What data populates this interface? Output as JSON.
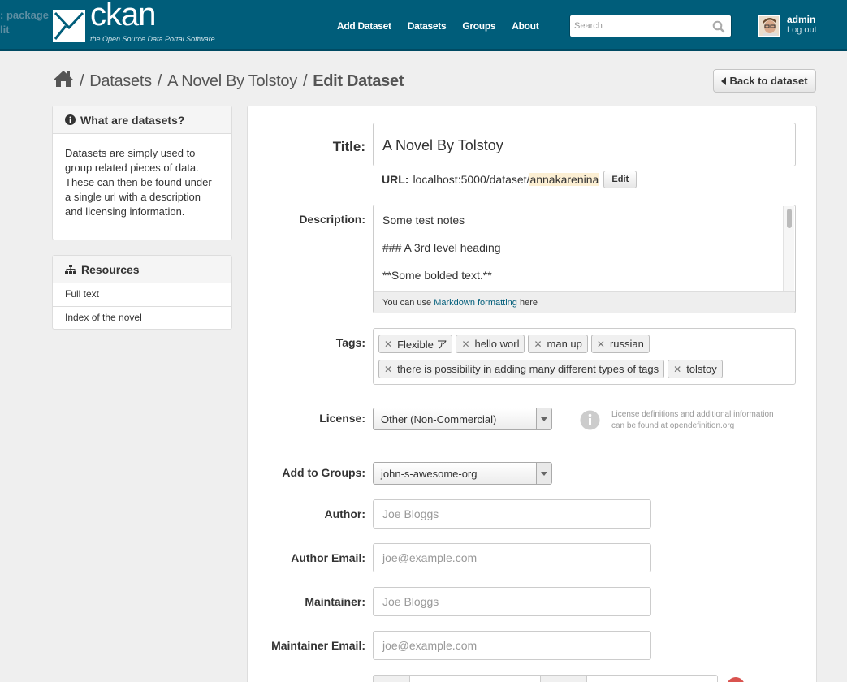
{
  "header": {
    "stray_text_1": ": package",
    "stray_text_2": "lit",
    "brand_name": "ckan",
    "brand_tagline": "the Open Source Data Portal Software",
    "nav": [
      "Add Dataset",
      "Datasets",
      "Groups",
      "About"
    ],
    "search_placeholder": "Search",
    "user_name": "admin",
    "logout_label": "Log out"
  },
  "breadcrumb": {
    "items": [
      "Datasets",
      "A Novel By Tolstoy"
    ],
    "current": "Edit Dataset",
    "separator": "/"
  },
  "back_button": "Back to dataset",
  "sidebar": {
    "info_title": "What are datasets?",
    "info_text": "Datasets are simply used to group related pieces of data. These can then be found under a single url with a description and licensing information.",
    "resources_title": "Resources",
    "resources": [
      "Full text",
      "Index of the novel"
    ]
  },
  "form": {
    "title_label": "Title:",
    "title_value": "A Novel By Tolstoy",
    "url_label": "URL:",
    "url_prefix": "localhost:5000/dataset/",
    "url_slug": "annakarenina",
    "url_edit": "Edit",
    "description_label": "Description:",
    "description_lines": [
      "Some test notes",
      "### A 3rd level heading",
      "**Some bolded text.**"
    ],
    "markdown_hint_before": "You can use ",
    "markdown_hint_link": "Markdown formatting",
    "markdown_hint_after": " here",
    "tags_label": "Tags:",
    "tags_row1": [
      "Flexible ア",
      "hello worl",
      "man up",
      "russian"
    ],
    "tags_row2": [
      "there is possibility in adding many different types of tags",
      "tolstoy"
    ],
    "license_label": "License:",
    "license_value": "Other (Non-Commercial)",
    "license_help_1": "License definitions and additional information",
    "license_help_2": "can be found at ",
    "license_help_link": "opendefinition.org",
    "groups_label": "Add to Groups:",
    "groups_value": "john-s-awesome-org",
    "author_label": "Author:",
    "author_placeholder": "Joe Bloggs",
    "author_email_label": "Author Email:",
    "author_email_placeholder": "joe@example.com",
    "maintainer_label": "Maintainer:",
    "maintainer_placeholder": "Joe Bloggs",
    "maintainer_email_label": "Maintainer Email:",
    "maintainer_email_placeholder": "joe@example.com"
  },
  "colors": {
    "header_bg": "#005d7a",
    "slug_highlight": "#fcefd3",
    "link": "#005d7a"
  }
}
